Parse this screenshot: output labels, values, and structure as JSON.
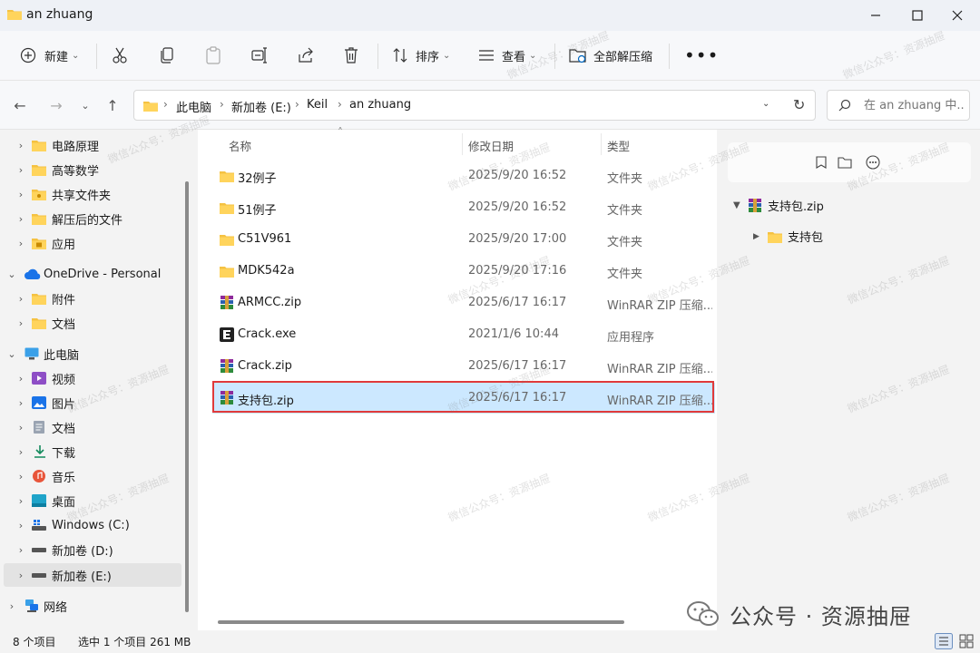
{
  "window": {
    "title": "an zhuang"
  },
  "commands": {
    "new_label": "新建",
    "sort_label": "排序",
    "view_label": "查看",
    "extract_all_label": "全部解压缩"
  },
  "address": {
    "crumbs": [
      "此电脑",
      "新加卷 (E:)",
      "Keil",
      "an zhuang"
    ]
  },
  "search": {
    "placeholder": "在 an zhuang 中..."
  },
  "nav": {
    "quick": [
      "电路原理",
      "高等数学",
      "共享文件夹",
      "解压后的文件",
      "应用"
    ],
    "onedrive": "OneDrive - Personal",
    "onedrive_children": [
      "附件",
      "文档"
    ],
    "this_pc": "此电脑",
    "pc_children": [
      "视频",
      "图片",
      "文档",
      "下载",
      "音乐",
      "桌面",
      "Windows (C:)",
      "新加卷 (D:)",
      "新加卷 (E:)"
    ],
    "network": "网络"
  },
  "columns": {
    "name": "名称",
    "date": "修改日期",
    "type": "类型"
  },
  "files": [
    {
      "name": "32例子",
      "date": "2025/9/20 16:52",
      "type": "文件夹",
      "icon": "folder-icon"
    },
    {
      "name": "51例子",
      "date": "2025/9/20 16:52",
      "type": "文件夹",
      "icon": "folder-icon"
    },
    {
      "name": "C51V961",
      "date": "2025/9/20 17:00",
      "type": "文件夹",
      "icon": "folder-icon"
    },
    {
      "name": "MDK542a",
      "date": "2025/9/20 17:16",
      "type": "文件夹",
      "icon": "folder-icon"
    },
    {
      "name": "ARMCC.zip",
      "date": "2025/6/17 16:17",
      "type": "WinRAR ZIP 压缩...",
      "icon": "winrar-icon"
    },
    {
      "name": "Crack.exe",
      "date": "2021/1/6 10:44",
      "type": "应用程序",
      "icon": "exe-icon"
    },
    {
      "name": "Crack.zip",
      "date": "2025/6/17 16:17",
      "type": "WinRAR ZIP 压缩...",
      "icon": "winrar-icon"
    },
    {
      "name": "支持包.zip",
      "date": "2025/6/17 16:17",
      "type": "WinRAR ZIP 压缩...",
      "icon": "winrar-icon"
    }
  ],
  "preview": {
    "archive": "支持包.zip",
    "child": "支持包"
  },
  "status": {
    "count": "8 个项目",
    "selection": "选中 1 个项目  261 MB"
  },
  "watermark": {
    "text": "微信公众号：资源抽屉",
    "brand": "公众号 · 资源抽屉"
  },
  "colors": {
    "accent": "#0067c0",
    "folder": "#f5c242",
    "selected_row": "#cce8ff",
    "highlight": "#e03a3a"
  }
}
